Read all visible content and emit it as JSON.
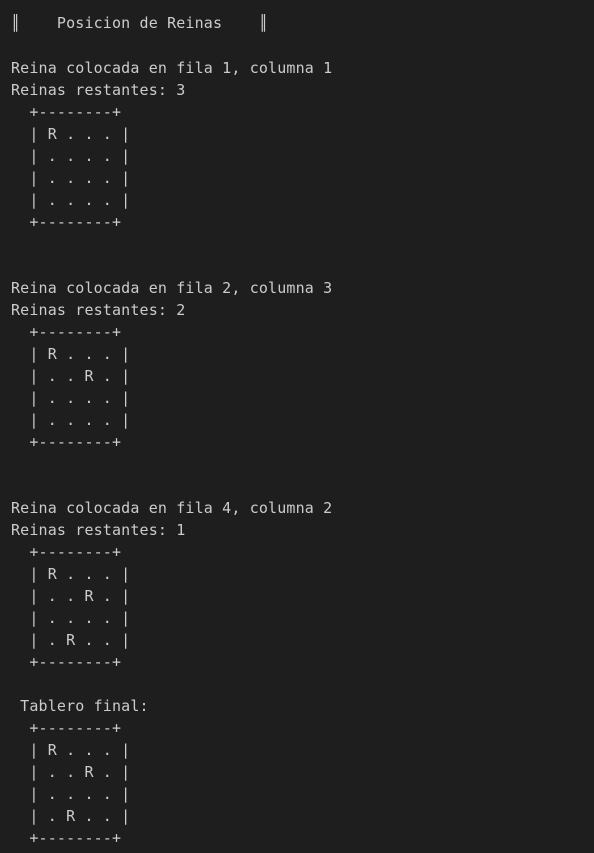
{
  "terminal": {
    "header": "║    Posicion de Reinas    ║",
    "steps": [
      {
        "placed": "Reina colocada en fila 1, columna 1",
        "remaining": "Reinas restantes: 3",
        "board": {
          "top": "  +--------+",
          "rows": [
            "  | R . . . |",
            "  | . . . . |",
            "  | . . . . |",
            "  | . . . . |"
          ],
          "bottom": "  +--------+"
        }
      },
      {
        "placed": "Reina colocada en fila 2, columna 3",
        "remaining": "Reinas restantes: 2",
        "board": {
          "top": "  +--------+",
          "rows": [
            "  | R . . . |",
            "  | . . R . |",
            "  | . . . . |",
            "  | . . . . |"
          ],
          "bottom": "  +--------+"
        }
      },
      {
        "placed": "Reina colocada en fila 4, columna 2",
        "remaining": "Reinas restantes: 1",
        "board": {
          "top": "  +--------+",
          "rows": [
            "  | R . . . |",
            "  | . . R . |",
            "  | . . . . |",
            "  | . R . . |"
          ],
          "bottom": "  +--------+"
        }
      }
    ],
    "final": {
      "label": " Tablero final:",
      "board": {
        "top": "  +--------+",
        "rows": [
          "  | R . . . |",
          "  | . . R . |",
          "  | . . . . |",
          "  | . R . . |"
        ],
        "bottom": "  +--------+"
      }
    }
  }
}
